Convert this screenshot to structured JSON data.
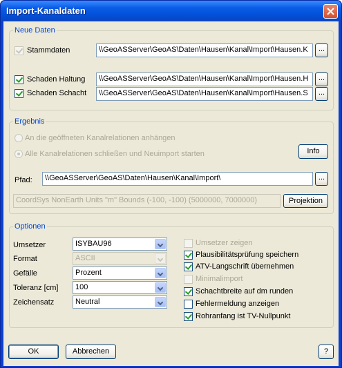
{
  "window": {
    "title": "Import-Kanaldaten"
  },
  "neue_daten": {
    "label": "Neue Daten",
    "stammdaten": {
      "label": "Stammdaten",
      "path": "\\\\GeoASServer\\GeoAS\\Daten\\Hausen\\Kanal\\Import\\Hausen.K",
      "browse": "..."
    },
    "haltung": {
      "label": "Schaden Haltung",
      "path": "\\\\GeoASServer\\GeoAS\\Daten\\Hausen\\Kanal\\Import\\Hausen.H",
      "browse": "..."
    },
    "schacht": {
      "label": "Schaden Schacht",
      "path": "\\\\GeoASServer\\GeoAS\\Daten\\Hausen\\Kanal\\Import\\Hausen.S",
      "browse": "..."
    }
  },
  "ergebnis": {
    "label": "Ergebnis",
    "radio1": "An die geöffneten Kanalrelationen anhängen",
    "radio2": "Alle Kanalrelationen schließen und Neuimport starten",
    "info": "Info",
    "pfad_label": "Pfad:",
    "pfad_value": "\\\\GeoASServer\\GeoAS\\Daten\\Hausen\\Kanal\\Import\\",
    "pfad_browse": "...",
    "coordsys": "CoordSys NonEarth Units \"m\" Bounds (-100, -100) (5000000, 7000000)",
    "projektion": "Projektion"
  },
  "optionen": {
    "label": "Optionen",
    "umsetzer": {
      "label": "Umsetzer",
      "value": "ISYBAU96"
    },
    "format": {
      "label": "Format",
      "value": "ASCII"
    },
    "gefaelle": {
      "label": "Gefälle",
      "value": "Prozent"
    },
    "toleranz": {
      "label": "Toleranz [cm]",
      "value": "100"
    },
    "zeichensatz": {
      "label": "Zeichensatz",
      "value": "Neutral"
    },
    "checks": [
      "Umsetzer zeigen",
      "Plausibilitätsprüfung speichern",
      "ATV-Langschrift übernehmen",
      "Minimalimport",
      "Schachtbreite auf dm runden",
      "Fehlermeldung anzeigen",
      "Rohranfang ist TV-Nullpunkt"
    ]
  },
  "footer": {
    "ok": "OK",
    "abbrechen": "Abbrechen",
    "help": "?"
  }
}
